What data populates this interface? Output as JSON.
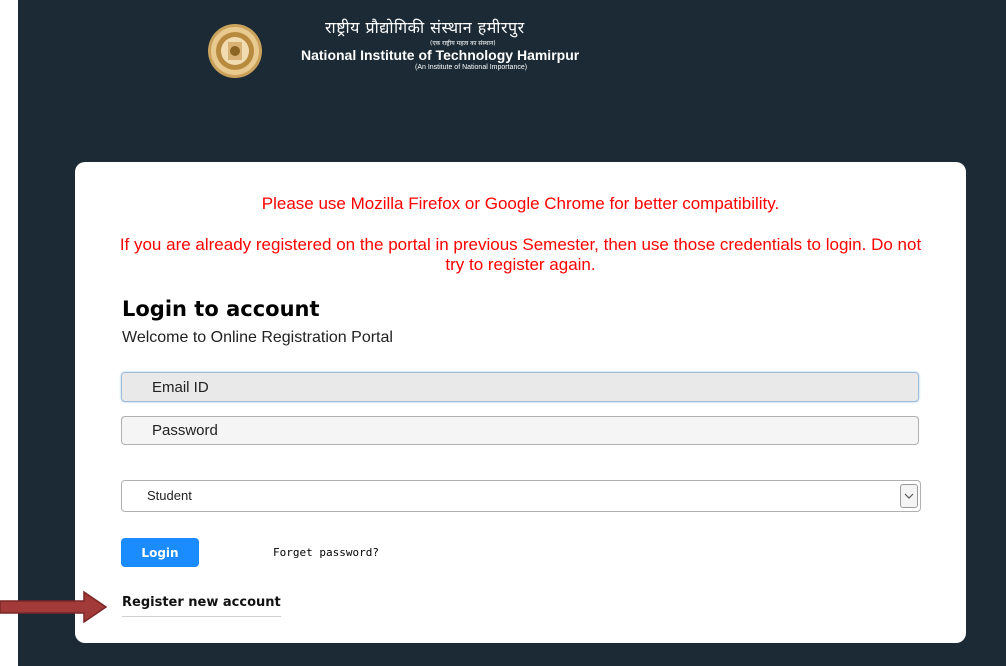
{
  "header": {
    "hindi_name": "राष्ट्रीय प्रौद्योगिकी संस्थान हमीरपुर",
    "hindi_subtitle": "(एक राष्ट्रीय महत्व का संस्थान)",
    "english_name": "National Institute of Technology Hamirpur",
    "english_subtitle": "(An Institute of National Importance)",
    "logo_icon": "institute-emblem-icon"
  },
  "notices": {
    "browser": "Please use Mozilla Firefox or Google Chrome for better compatibility.",
    "registered": "If you are already registered on the portal in previous Semester, then use those credentials to login. Do not try to register again."
  },
  "login": {
    "title": "Login to account",
    "subtitle": "Welcome to Online Registration Portal",
    "email_placeholder": "Email ID",
    "email_value": "",
    "password_placeholder": "Password",
    "password_value": "",
    "role_selected": "Student",
    "login_label": "Login",
    "forgot_label": "Forget password?",
    "register_label": "Register new account"
  },
  "colors": {
    "page_background": "#1b2a34",
    "notice_text": "#ff0000",
    "login_button": "#1a8cff",
    "annotation_arrow": "#a33a3a"
  },
  "annotation": {
    "arrow_icon": "arrow-right-icon"
  }
}
